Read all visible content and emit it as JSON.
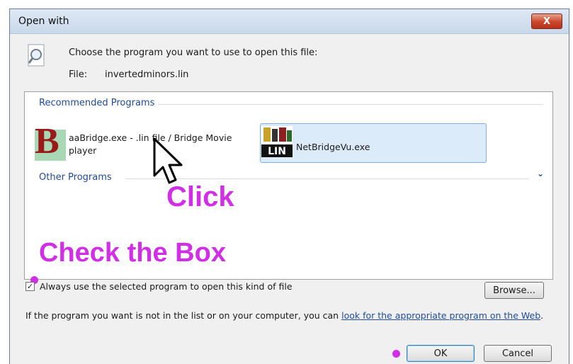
{
  "window": {
    "title": "Open with",
    "close_label": "X"
  },
  "header": {
    "prompt": "Choose the program you want to use to open this file:",
    "file_label": "File:",
    "file_name": "invertedminors.lin"
  },
  "programs": {
    "recommended_heading": "Recommended Programs",
    "other_heading": "Other Programs",
    "items": [
      {
        "name": "aaBridge.exe - .lin file / Bridge Movie player",
        "icon": "aabridge-icon",
        "selected": false
      },
      {
        "name": "NetBridgeVu.exe",
        "icon": "lin-file-icon",
        "icon_text": "LIN",
        "selected": true
      }
    ]
  },
  "annotations": {
    "click": "Click",
    "check": "Check the Box",
    "color": "#d12fe6"
  },
  "footer": {
    "always_use_label": "Always use the selected program to open this kind of file",
    "always_use_checked": true,
    "browse_label": "Browse...",
    "info_text": "If the program you want is not in the list or on your computer, you can",
    "info_link": "look for the appropriate program on the Web",
    "info_end": ".",
    "ok_label": "OK",
    "cancel_label": "Cancel"
  },
  "colors": {
    "link": "#1e4a9e",
    "selection": "#dcebfa",
    "close": "#c9462b"
  }
}
